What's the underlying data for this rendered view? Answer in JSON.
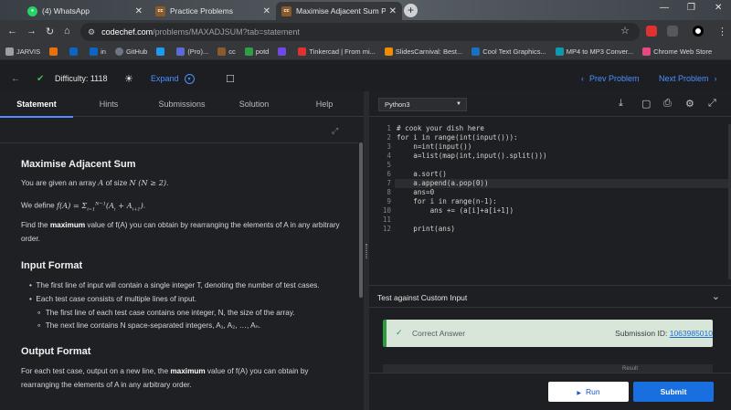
{
  "browser": {
    "tabs": [
      {
        "title": "(4) WhatsApp",
        "icon": "whatsapp-icon",
        "color": "#25D366"
      },
      {
        "title": "Practice Problems",
        "icon": "codechef-icon",
        "color": "#8B5A2B"
      },
      {
        "title": "Maximise Adjacent Sum Practic",
        "icon": "codechef-icon",
        "color": "#8B5A2B"
      }
    ],
    "url_domain": "codechef.com",
    "url_path": "/problems/MAXADJSUM?tab=statement",
    "bookmarks": [
      {
        "label": "JARVIS",
        "color": "#9aa0a6"
      },
      {
        "label": "",
        "color": "#e8710a"
      },
      {
        "label": "",
        "color": "#0a66c2"
      },
      {
        "label": "in",
        "color": "#0a66c2"
      },
      {
        "label": "GitHub",
        "color": "#6e7681"
      },
      {
        "label": "",
        "color": "#1d9bf0"
      },
      {
        "label": "(Pro)...",
        "color": "#5b6bd6"
      },
      {
        "label": "cc",
        "color": "#8B5A2B"
      },
      {
        "label": "potd",
        "color": "#2f9e44"
      },
      {
        "label": "",
        "color": "#7048e8"
      },
      {
        "label": "Tinkercad | From mi...",
        "color": "#e03131"
      },
      {
        "label": "SlidesCarnival: Best...",
        "color": "#f08c00"
      },
      {
        "label": "Cool Text Graphics...",
        "color": "#1971c2"
      },
      {
        "label": "MP4 to MP3 Conver...",
        "color": "#1098ad"
      },
      {
        "label": "Chrome Web Store",
        "color": "#e64980"
      }
    ]
  },
  "header": {
    "difficulty": "Difficulty: 1118",
    "expand": "Expand",
    "prev": "Prev Problem",
    "next": "Next Problem"
  },
  "left_tabs": [
    "Statement",
    "Hints",
    "Submissions",
    "Solution",
    "Help"
  ],
  "problem": {
    "title": "Maximise Adjacent Sum",
    "intro_pre": "You are given an array",
    "intro_mid": "of size",
    "define_pre": "We define",
    "find_pre": "Find the",
    "find_bold": "maximum",
    "find_post": "value of f(A) you can obtain by rearranging the elements of A in any arbitrary order.",
    "input_heading": "Input Format",
    "input_items": [
      "The first line of input will contain a single integer T, denoting the number of test cases.",
      "Each test case consists of multiple lines of input.",
      "The first line of each test case contains one integer, N, the size of the array.",
      "The next line contains N space-separated integers, A₁, A₂, …, Aₙ."
    ],
    "output_heading": "Output Format",
    "output_pre": "For each test case, output on a new line, the",
    "output_bold": "maximum",
    "output_post": "value of f(A) you can obtain by rearranging the elements of A in any arbitrary order."
  },
  "editor": {
    "language": "Python3",
    "lines": [
      "# cook your dish here",
      "for i in range(int(input())):",
      "    n=int(input())",
      "    a=list(map(int,input().split()))",
      "",
      "    a.sort()",
      "    a.append(a.pop(0))",
      "    ans=0",
      "    for i in range(n-1):",
      "        ans += (a[i]+a[i+1])",
      "",
      "    print(ans)"
    ]
  },
  "custom_input_label": "Test against Custom Input",
  "result": {
    "status": "Correct Answer",
    "submission_label": "Submission ID:",
    "submission_id": "1063985010",
    "partial": "Result"
  },
  "buttons": {
    "run": "Run",
    "submit": "Submit"
  }
}
